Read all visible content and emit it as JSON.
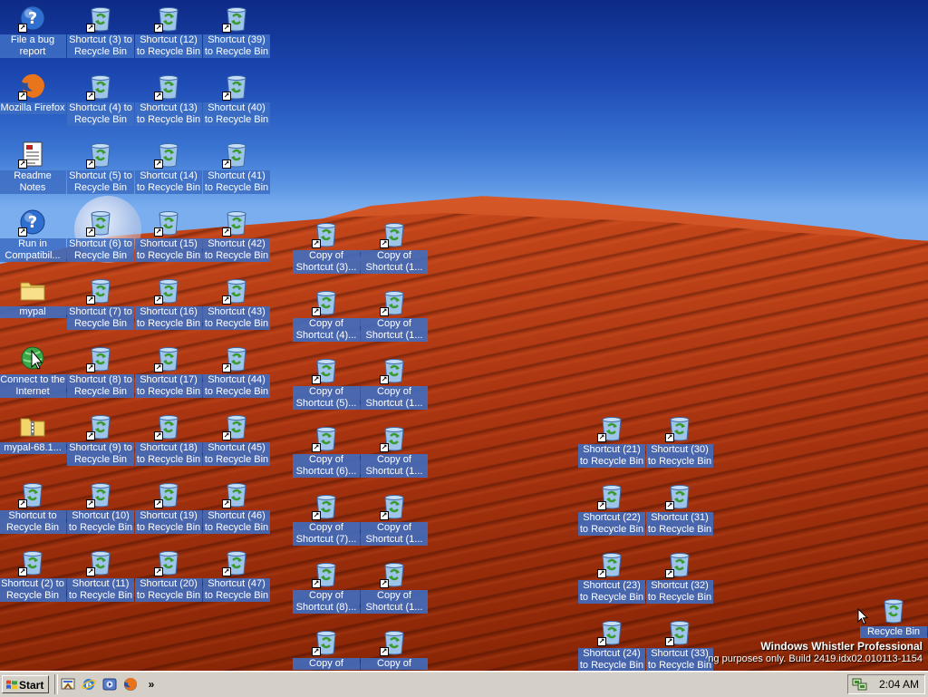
{
  "colors": {
    "sky_top": "#0d2a86",
    "sky_bottom": "#7aaeef",
    "dune": "#b83d14",
    "label_bg": "#3e6ec4",
    "taskbar": "#d4d0c8"
  },
  "desktop": {
    "column1": [
      {
        "label": "File a bug report",
        "icon": "help-icon",
        "shortcut": true
      },
      {
        "label": "Mozilla Firefox",
        "icon": "firefox-icon",
        "shortcut": true
      },
      {
        "label": "Readme Notes",
        "icon": "notes-document-icon",
        "shortcut": true
      },
      {
        "label": "Run in Compatibil...",
        "icon": "help-icon",
        "shortcut": true
      },
      {
        "label": "mypal",
        "icon": "folder-icon",
        "shortcut": false
      },
      {
        "label": "Connect to the Internet",
        "icon": "internet-connection-icon",
        "shortcut": false
      },
      {
        "label": "mypal-68.1...",
        "icon": "zip-folder-icon",
        "shortcut": false
      },
      {
        "label": "Shortcut to Recycle Bin",
        "icon": "recycle-bin-icon",
        "shortcut": true
      },
      {
        "label": "Shortcut (2) to Recycle Bin",
        "icon": "recycle-bin-icon",
        "shortcut": true
      }
    ],
    "column2": [
      "Shortcut (3) to Recycle Bin",
      "Shortcut (4) to Recycle Bin",
      "Shortcut (5) to Recycle Bin",
      "Shortcut (6) to Recycle Bin",
      "Shortcut (7) to Recycle Bin",
      "Shortcut (8) to Recycle Bin",
      "Shortcut (9) to Recycle Bin",
      "Shortcut (10) to Recycle Bin",
      "Shortcut (11) to Recycle Bin"
    ],
    "column3": [
      "Shortcut (12) to Recycle Bin",
      "Shortcut (13) to Recycle Bin",
      "Shortcut (14) to Recycle Bin",
      "Shortcut (15) to Recycle Bin",
      "Shortcut (16) to Recycle Bin",
      "Shortcut (17) to Recycle Bin",
      "Shortcut (18) to Recycle Bin",
      "Shortcut (19) to Recycle Bin",
      "Shortcut (20) to Recycle Bin"
    ],
    "column4": [
      "Shortcut (39) to Recycle Bin",
      "Shortcut (40) to Recycle Bin",
      "Shortcut (41) to Recycle Bin",
      "Shortcut (42) to Recycle Bin",
      "Shortcut (43) to Recycle Bin",
      "Shortcut (44) to Recycle Bin",
      "Shortcut (45) to Recycle Bin",
      "Shortcut (46) to Recycle Bin",
      "Shortcut (47) to Recycle Bin"
    ],
    "column5": [
      "Copy of Shortcut (3)...",
      "Copy of Shortcut (4)...",
      "Copy of Shortcut (5)...",
      "Copy of Shortcut (6)...",
      "Copy of Shortcut (7)...",
      "Copy of Shortcut (8)...",
      "Copy of"
    ],
    "column6": [
      "Copy of Shortcut (1...",
      "Copy of Shortcut (1...",
      "Copy of Shortcut (1...",
      "Copy of Shortcut (1...",
      "Copy of Shortcut (1...",
      "Copy of Shortcut (1...",
      "Copy of"
    ],
    "column7": [
      "Shortcut (21) to Recycle Bin",
      "Shortcut (22) to Recycle Bin",
      "Shortcut (23) to Recycle Bin",
      "Shortcut (24) to Recycle Bin"
    ],
    "column8": [
      "Shortcut (30) to Recycle Bin",
      "Shortcut (31) to Recycle Bin",
      "Shortcut (32) to Recycle Bin",
      "Shortcut (33) to Recycle Bin"
    ],
    "recycle_bin": {
      "label": "Recycle Bin",
      "icon": "recycle-bin-icon"
    }
  },
  "watermark": {
    "edition": "Windows Whistler Professional",
    "build": "ng purposes only. Build 2419.idx02.010113-1154"
  },
  "taskbar": {
    "start_label": "Start",
    "quick_launch": [
      {
        "icon": "show-desktop-icon"
      },
      {
        "icon": "internet-explorer-icon"
      },
      {
        "icon": "media-player-icon"
      },
      {
        "icon": "firefox-icon"
      }
    ],
    "more_label": "»",
    "tray_icon": "network-tray-icon",
    "clock": "2:04 AM"
  }
}
